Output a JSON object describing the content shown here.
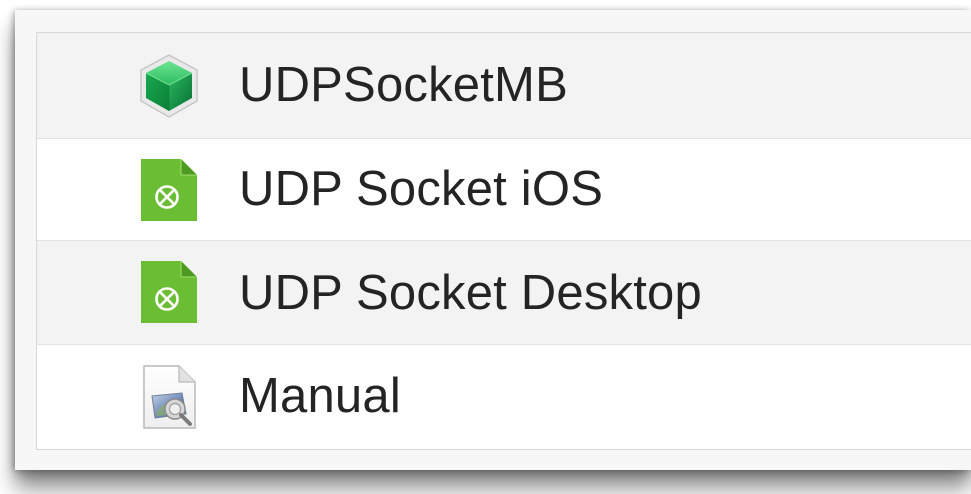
{
  "file_list": {
    "items": [
      {
        "label": "UDPSocketMB",
        "icon": "green-cube-project-icon"
      },
      {
        "label": "UDP Socket iOS",
        "icon": "green-document-icon"
      },
      {
        "label": "UDP Socket Desktop",
        "icon": "green-document-icon"
      },
      {
        "label": "Manual",
        "icon": "preview-document-icon"
      }
    ]
  },
  "colors": {
    "row_alternate": "#f3f3f4",
    "text": "#242424",
    "document_green": "#6bbd34",
    "cube_green": "#22a85a"
  }
}
